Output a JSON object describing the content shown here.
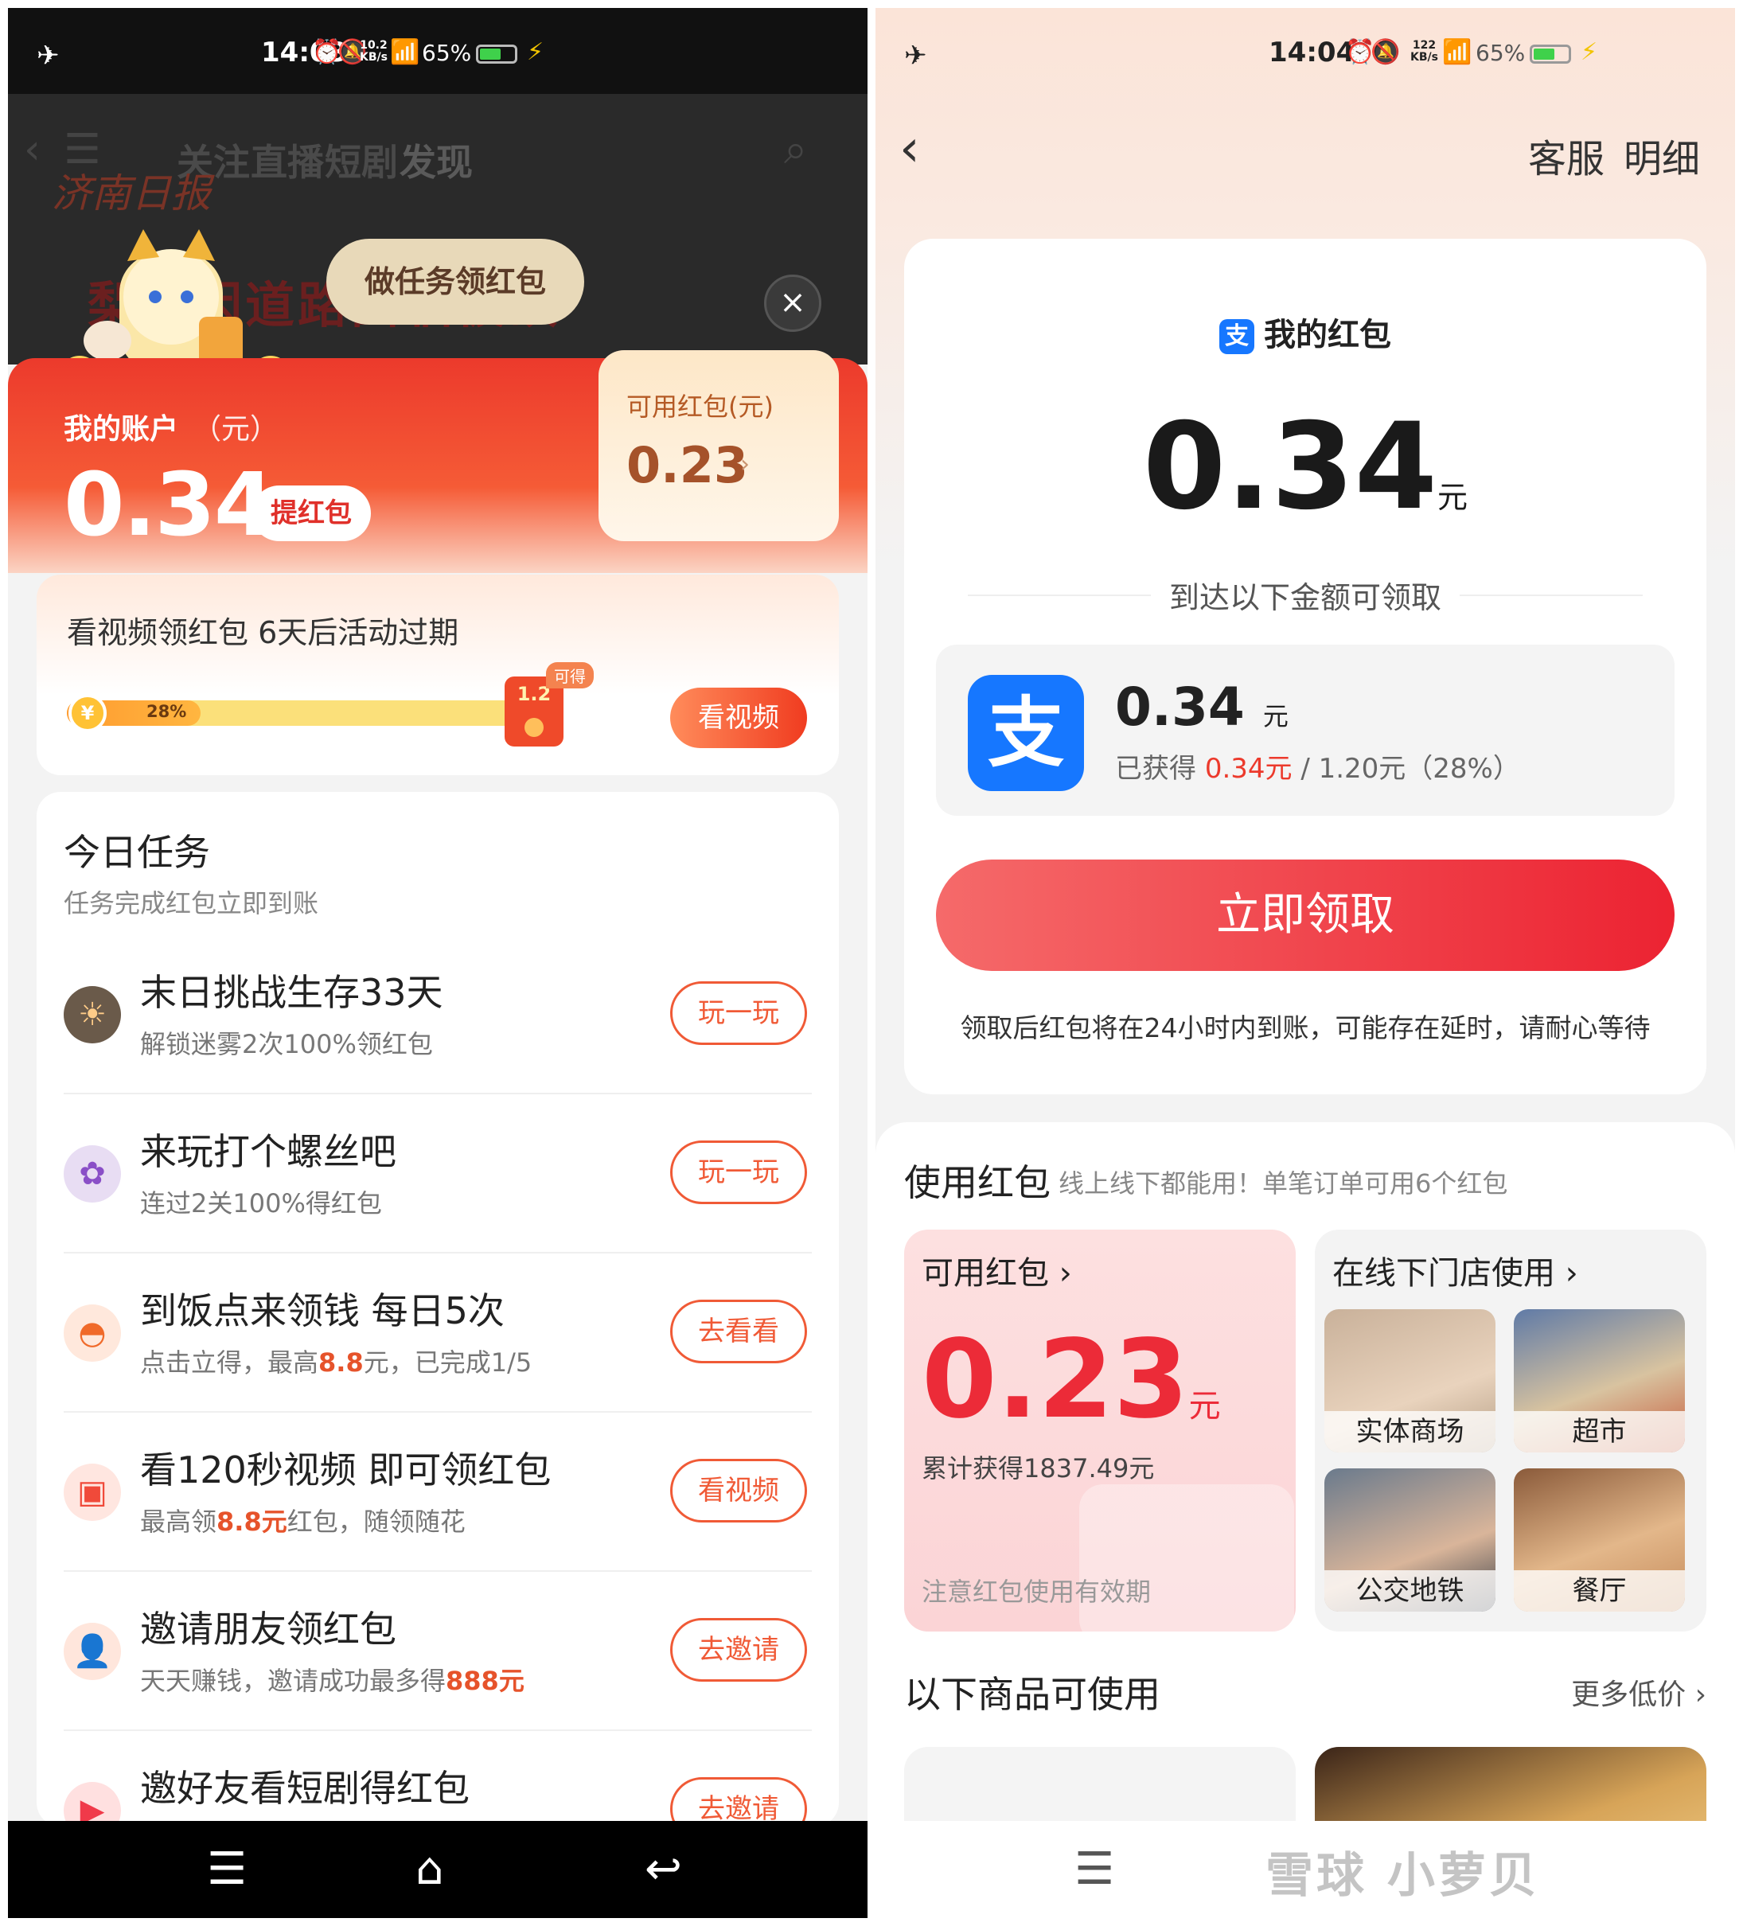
{
  "left": {
    "status": {
      "time": "14:03",
      "net_speed_top": "10.2",
      "net_speed_unit": "KB/s",
      "battery": "65%",
      "battery_level": 0.65
    },
    "background": {
      "tabs": [
        "关注",
        "直播",
        "短剧",
        "发现"
      ],
      "logo": "济南日报",
      "headline": "梨树因道路面临被砍"
    },
    "popup_bubble": "做任务领红包",
    "account": {
      "title": "我的账户",
      "unit": "（元）",
      "amount": "0.34",
      "withdraw_label": "提红包",
      "available_label": "可用红包(元)",
      "available_value": "0.23"
    },
    "video_progress": {
      "title": "看视频领红包 6天后活动过期",
      "percent_text": "28%",
      "progress": 0.28,
      "goal": "1.2",
      "tag": "可得",
      "button": "看视频"
    },
    "tasks": {
      "title": "今日任务",
      "subtitle": "任务完成红包立即到账",
      "items": [
        {
          "name": "末日挑战生存33天",
          "desc": [
            "解锁迷雾2次100%领红包"
          ],
          "button": "玩一玩",
          "icon": "game-survival-icon"
        },
        {
          "name": "来玩打个螺丝吧",
          "desc": [
            "连过2关100%得红包"
          ],
          "button": "玩一玩",
          "icon": "game-screw-icon"
        },
        {
          "name": "到饭点来领钱 每日5次",
          "desc": [
            "点击立得，最高",
            "8.8",
            "元，已完成1/5"
          ],
          "button": "去看看",
          "icon": "meal-bowl-icon"
        },
        {
          "name": "看120秒视频 即可领红包",
          "desc": [
            "最高领",
            "8.8元",
            "红包，随领随花"
          ],
          "button": "看视频",
          "icon": "video-icon"
        },
        {
          "name": "邀请朋友领红包",
          "desc": [
            "天天赚钱，邀请成功最多得",
            "888元",
            ""
          ],
          "button": "去邀请",
          "icon": "invite-user-icon"
        },
        {
          "name": "邀好友看短剧得红包",
          "desc": [
            ""
          ],
          "button": "去邀请",
          "icon": "drama-play-icon"
        }
      ]
    }
  },
  "right": {
    "status": {
      "time": "14:04",
      "net_speed_top": "122",
      "net_speed_unit": "KB/s",
      "battery": "65%",
      "battery_level": 0.65
    },
    "header": {
      "service": "客服",
      "detail": "明细"
    },
    "redpacket": {
      "title": "我的红包",
      "amount": "0.34",
      "unit": "元",
      "reach_text": "到达以下金额可领取",
      "alipay_amount": "0.34",
      "alipay_unit": "元",
      "earned_prefix": "已获得 ",
      "earned_value": "0.34元",
      "earned_suffix": " / 1.20元（28%）",
      "claim_button": "立即领取",
      "claim_note": "领取后红包将在24小时内到账，可能存在延时，请耐心等待"
    },
    "use": {
      "title": "使用红包",
      "subtitle": "线上线下都能用！单笔订单可用6个红包",
      "available_label": "可用红包 ›",
      "available_value": "0.23",
      "available_unit": "元",
      "total_earned": "累计获得1837.49元",
      "note": "注意红包使用有效期",
      "offline_label": "在线下门店使用 ›",
      "tiles": [
        "实体商场",
        "超市",
        "公交地铁",
        "餐厅"
      ]
    },
    "goods": {
      "title": "以下商品可使用",
      "more": "更多低价 ›"
    },
    "watermark": "雪球 小萝贝"
  }
}
